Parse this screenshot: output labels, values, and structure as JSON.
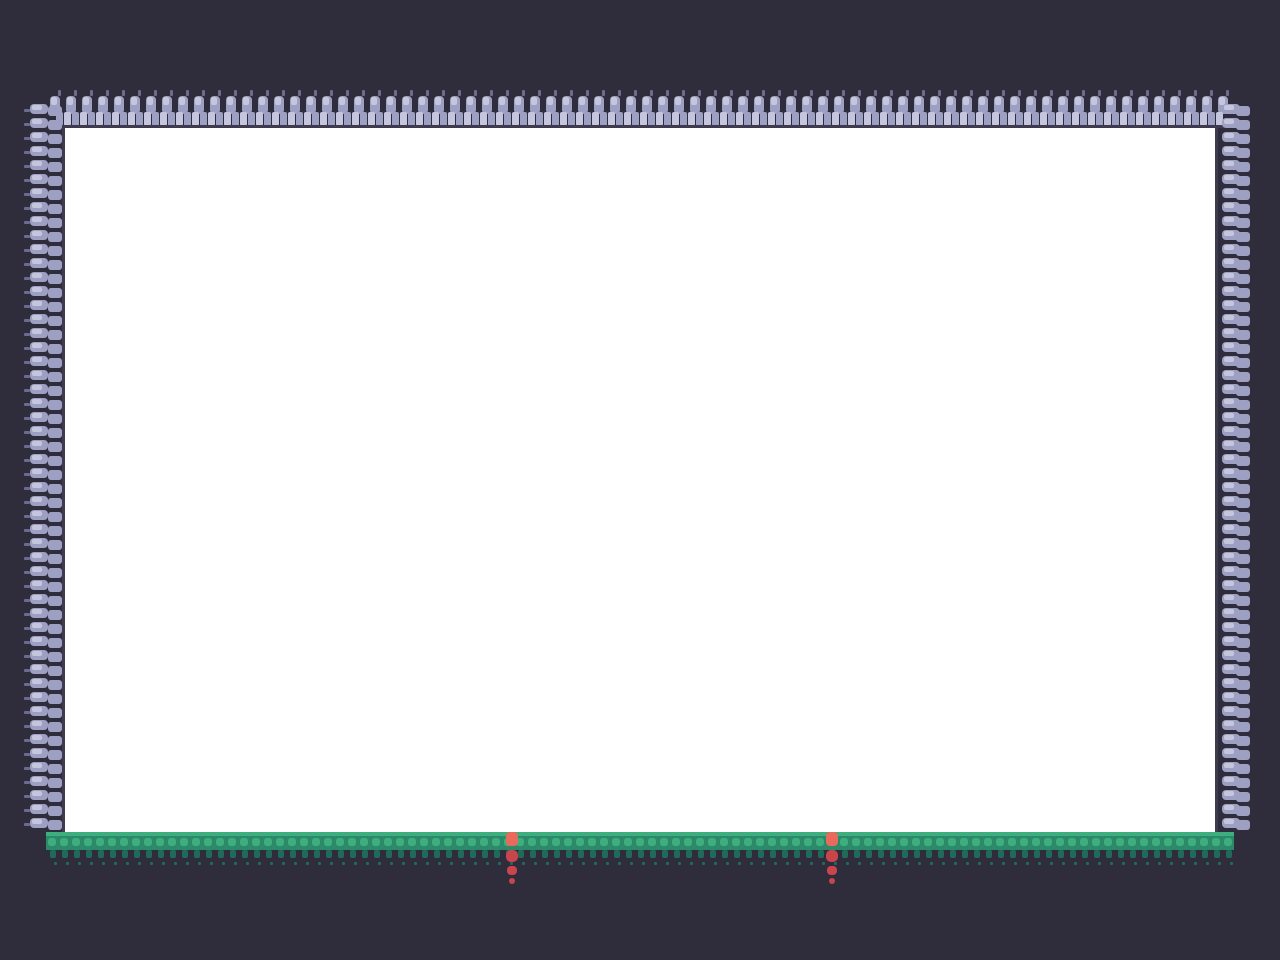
{
  "game": {
    "title": "",
    "palette": {
      "background": "#2f2d3b",
      "play_area": "#ffffff",
      "stone_light": "#c5c6dd",
      "stone_mid": "#9da0c2",
      "stone_dark": "#6d6a91",
      "stone_shadow": "#514d72",
      "edge_outline": "#3d3b4d",
      "grass_top": "#3fae7e",
      "grass_mid": "#2c8a6a",
      "grass_dark": "#1f6a5a",
      "vine_red": "#c8464b",
      "vine_light": "#e76a5a"
    },
    "tiles": {
      "top_wall": "cobblestone",
      "left_wall": "cobblestone",
      "right_wall": "cobblestone",
      "floor": "grass",
      "hanging_vines": 2
    }
  }
}
